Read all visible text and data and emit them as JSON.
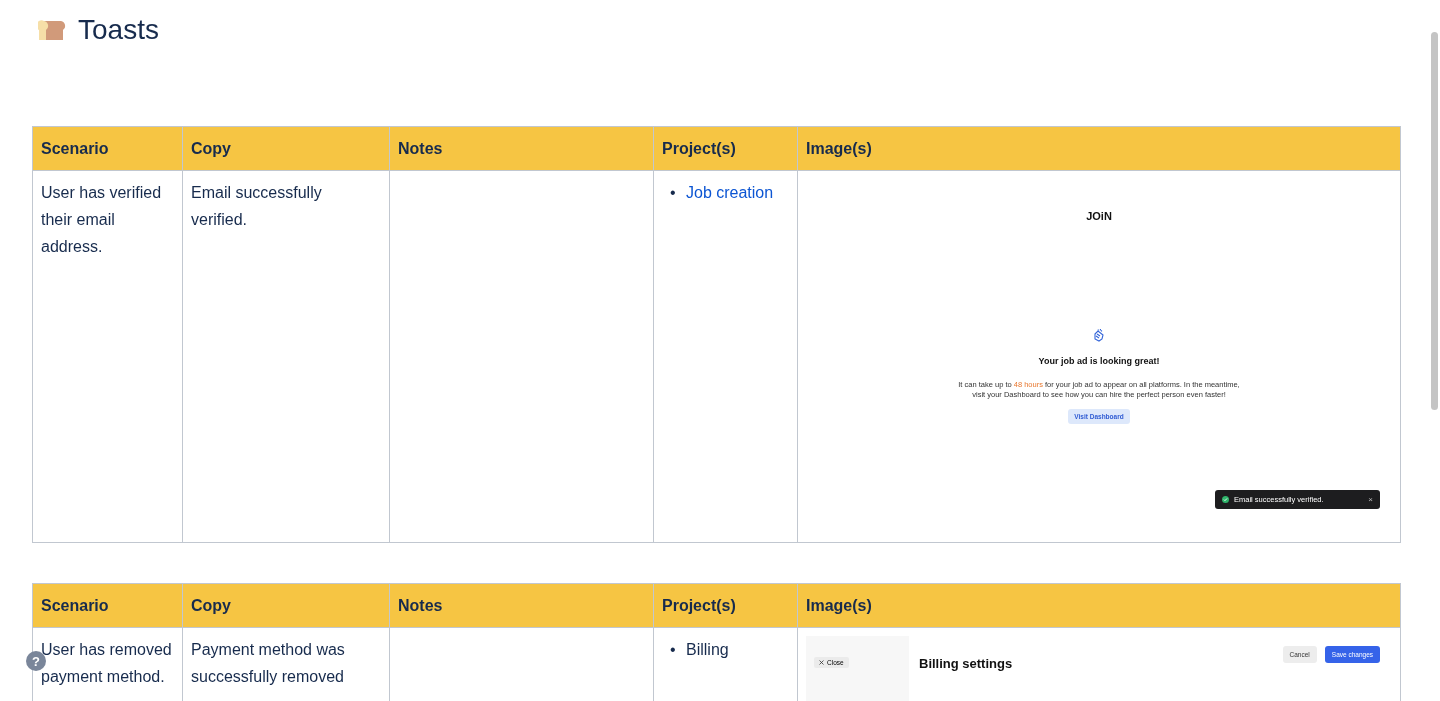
{
  "page": {
    "title": "Toasts"
  },
  "tables": [
    {
      "columns": [
        "Scenario",
        "Copy",
        "Notes",
        "Project(s)",
        "Image(s)"
      ],
      "row": {
        "scenario": "User has verified their email address.",
        "copy": "Email successfully verified.",
        "projects": [
          {
            "marker": "•",
            "label": "Job creation",
            "kind": "link"
          }
        ],
        "image": {
          "kind": "job_ad",
          "logo": "JOiN",
          "heading": "Your job ad is looking great!",
          "body_before": "It can take up to ",
          "highlight": "48 hours",
          "body_after": " for your job ad to appear on all platforms. In the meantime, visit your Dashboard to see how you can hire the perfect person even faster!",
          "button": "Visit Dashboard",
          "toast": "Email successfully verified.",
          "toast_close": "×"
        }
      }
    },
    {
      "columns": [
        "Scenario",
        "Copy",
        "Notes",
        "Project(s)",
        "Image(s)"
      ],
      "row": {
        "scenario": "User has removed payment method.",
        "copy": "Payment method was successfully removed",
        "projects": [
          {
            "marker": "•",
            "label": "Billing",
            "kind": "text"
          }
        ],
        "image": {
          "kind": "billing",
          "close": "Close",
          "title": "Billing settings",
          "cancel": "Cancel",
          "save": "Save changes"
        }
      }
    }
  ],
  "help_button": "?"
}
